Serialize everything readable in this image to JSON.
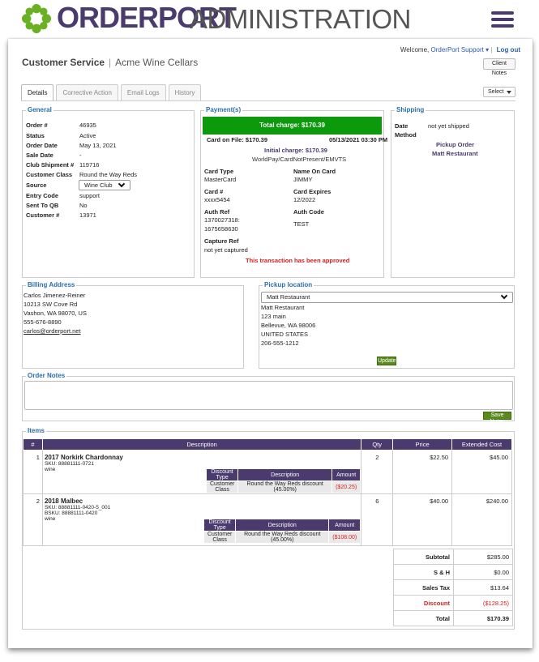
{
  "brand": {
    "name_bold": "ORDERPORT",
    "name_light": "ADMINISTRATION"
  },
  "header": {
    "welcome": "Welcome,",
    "user": "OrderPort Support",
    "logout": "Log out",
    "client_notes": "Client Notes"
  },
  "page": {
    "section": "Customer Service",
    "company": "Acme Wine Cellars"
  },
  "tabs": [
    "Details",
    "Corrective Action",
    "Email Logs",
    "History"
  ],
  "select_label": "Select",
  "general": {
    "legend": "General",
    "rows": [
      {
        "label": "Order #",
        "value": "46935"
      },
      {
        "label": "Status",
        "value": "Active"
      },
      {
        "label": "Order Date",
        "value": "May 13, 2021"
      },
      {
        "label": "Sale Date",
        "value": "-"
      },
      {
        "label": "Club Shipment #",
        "value": "119716"
      },
      {
        "label": "Customer Class",
        "value": "Round the Way Reds"
      },
      {
        "label": "Source",
        "value": "Wine Club"
      },
      {
        "label": "Entry Code",
        "value": "support"
      },
      {
        "label": "Sent To QB",
        "value": "No"
      },
      {
        "label": "Customer #",
        "value": "13971"
      }
    ]
  },
  "payment": {
    "legend": "Payment(s)",
    "total_charge": "Total charge: $170.39",
    "card_on_file": "Card on File: $170.39",
    "date": "05/13/2021 03:30 PM",
    "initial_charge": "Initial charge: $170.39",
    "gateway": "WorldPay/CardNotPresent/EMVTS",
    "card_type_label": "Card Type",
    "card_type": "MasterCard",
    "name_label": "Name On Card",
    "name": "JIMMY",
    "card_num_label": "Card #",
    "card_num": "xxxx5454",
    "expires_label": "Card Expires",
    "expires": "12/2022",
    "auth_ref_label": "Auth Ref",
    "auth_ref_1": "1370027318:",
    "auth_ref_2": "1675658630",
    "auth_code_label": "Auth Code",
    "auth_code": "TEST",
    "capture_label": "Capture Ref",
    "capture": "not yet captured",
    "approved": "This transaction has been approved"
  },
  "shipping": {
    "legend": "Shipping",
    "date_label": "Date",
    "date_value": "not yet shipped",
    "method_label": "Method",
    "method_1": "Pickup Order",
    "method_2": "Matt Restaurant"
  },
  "billing": {
    "legend": "Billing Address",
    "lines": [
      "Carlos Jimenez-Reiner",
      "10213 SW Cove Rd",
      "Vashon, WA 98070, US",
      "555-676-8890"
    ],
    "email": "carlos@orderport.net"
  },
  "pickup": {
    "legend": "Pickup location",
    "selected": "Matt Restaurant",
    "lines": [
      "Matt Restaurant",
      "123 main",
      "Bellevue, WA 98006",
      "UNITED STATES",
      "206-555-1212"
    ],
    "update": "Update"
  },
  "notes": {
    "legend": "Order Notes",
    "save": "Save Notes"
  },
  "items": {
    "legend": "Items",
    "headers": [
      "#",
      "Description",
      "Qty",
      "Price",
      "Extended Cost"
    ],
    "sub_headers": [
      "Discount Type",
      "Description",
      "Amount"
    ],
    "rows": [
      {
        "num": "1",
        "name": "2017 Norkirk Chardonnay",
        "sku": "SKU: 88881111-0721",
        "bsku": "",
        "type": "wine",
        "qty": "2",
        "price": "$22.50",
        "ext": "$45.00",
        "disc_type": "Customer Class",
        "disc_desc": "Round the Way Reds discount (45.00%)",
        "disc_amt": "($20.25)"
      },
      {
        "num": "2",
        "name": "2018 Malbec",
        "sku": "SKU: 88881111-0420-5_001",
        "bsku": "BSKU: 88881111-0420",
        "type": "wine",
        "qty": "6",
        "price": "$40.00",
        "ext": "$240.00",
        "disc_type": "Customer Class",
        "disc_desc": "Round the Way Reds discount (45.00%)",
        "disc_amt": "($108.00)"
      }
    ]
  },
  "totals": [
    {
      "label": "Subtotal",
      "value": "$285.00"
    },
    {
      "label": "S & H",
      "value": "$0.00"
    },
    {
      "label": "Sales Tax",
      "value": "$13.64"
    },
    {
      "label": "Discount",
      "value": "($128.25)"
    },
    {
      "label": "Total",
      "value": "$170.39"
    }
  ],
  "colors": {
    "brand": "#4a3a6e",
    "logo_green": "#6ab023",
    "approved_green": "#0c9a0c",
    "legend_blue": "#2a6fa8"
  }
}
